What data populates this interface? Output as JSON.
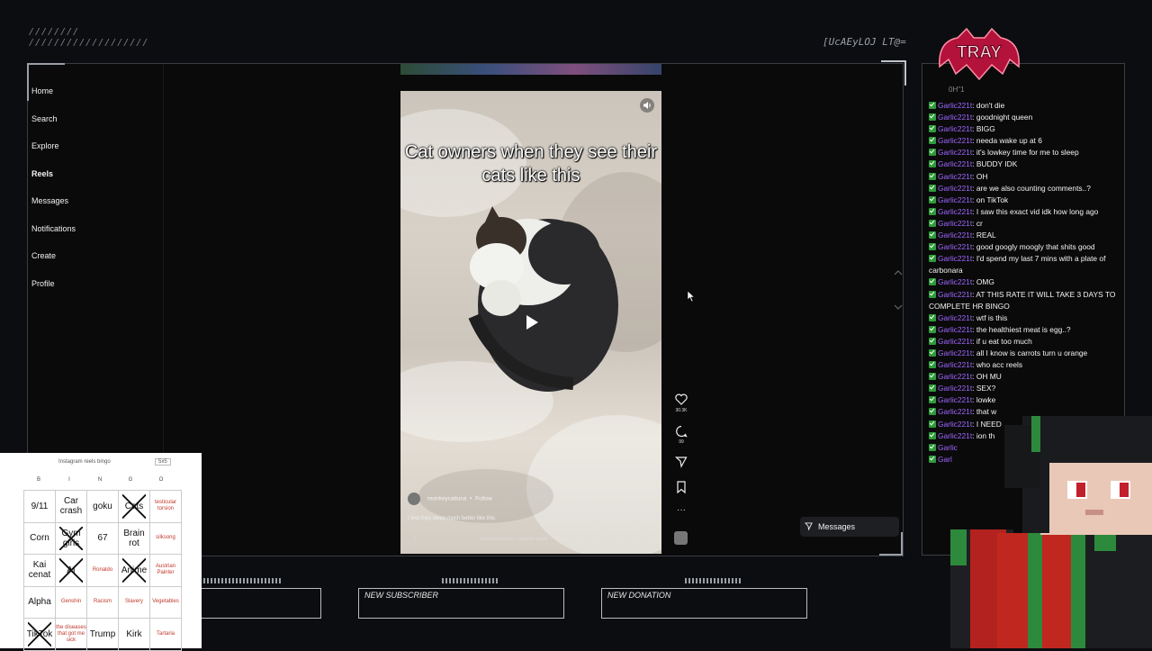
{
  "overlay": {
    "top_left_hatch_1": "////////",
    "top_left_hatch_2": "///////////////////",
    "top_code": "[UcAEyLOJ LT@=",
    "logo_text": "TRAY",
    "chat_top_text": "0H\"1"
  },
  "sidebar": {
    "items": [
      {
        "label": "Home"
      },
      {
        "label": "Search"
      },
      {
        "label": "Explore"
      },
      {
        "label": "Reels",
        "active": true
      },
      {
        "label": "Messages"
      },
      {
        "label": "Notifications"
      },
      {
        "label": "Create"
      },
      {
        "label": "Profile"
      }
    ]
  },
  "reel": {
    "caption": "Cat owners when they see their cats like this",
    "username": "monkeycatluna",
    "follow_label": "Follow",
    "description": "I feel they sleep much better like this",
    "audio": "monkeycatluna · Original audio",
    "like_count": "30.3K",
    "comment_count": "99"
  },
  "messages_button": {
    "label": "Messages"
  },
  "alerts": {
    "new_subscriber": "NEW SUBSCRIBER",
    "new_donation": "NEW DONATION"
  },
  "chat": {
    "messages": [
      {
        "user": "Garlic221t",
        "text": "don't die"
      },
      {
        "user": "Garlic221t",
        "text": "goodnight queen"
      },
      {
        "user": "Garlic221t",
        "text": "BIGG"
      },
      {
        "user": "Garlic221t",
        "text": "needa wake up at 6"
      },
      {
        "user": "Garlic221t",
        "text": "it's lowkey time for me to sleep"
      },
      {
        "user": "Garlic221t",
        "text": "BUDDY IDK"
      },
      {
        "user": "Garlic221t",
        "text": "OH"
      },
      {
        "user": "Garlic221t",
        "text": "are we also counting comments..?"
      },
      {
        "user": "Garlic221t",
        "text": "on TikTok"
      },
      {
        "user": "Garlic221t",
        "text": "I saw this exact vid idk how long ago"
      },
      {
        "user": "Garlic221t",
        "text": "cr"
      },
      {
        "user": "Garlic221t",
        "text": "REAL"
      },
      {
        "user": "Garlic221t",
        "text": "good googly moogly that shits good"
      },
      {
        "user": "Garlic221t",
        "text": "I'd spend my last 7 mins with a plate of carbonara"
      },
      {
        "user": "Garlic221t",
        "text": "OMG"
      },
      {
        "user": "Garlic221t",
        "text": "AT THIS RATE IT WILL TAKE 3 DAYS TO COMPLETE HR BINGO"
      },
      {
        "user": "Garlic221t",
        "text": "wtf is this"
      },
      {
        "user": "Garlic221t",
        "text": "the healthiest meat is egg..?"
      },
      {
        "user": "Garlic221t",
        "text": "if u eat too much"
      },
      {
        "user": "Garlic221t",
        "text": "all I know is carrots turn u orange"
      },
      {
        "user": "Garlic221t",
        "text": "who acc reels"
      },
      {
        "user": "Garlic221t",
        "text": "OH MU"
      },
      {
        "user": "Garlic221t",
        "text": "SEX?"
      },
      {
        "user": "Garlic221t",
        "text": "lowke"
      },
      {
        "user": "Garlic221t",
        "text": "that w"
      },
      {
        "user": "Garlic221t",
        "text": "I NEED"
      },
      {
        "user": "Garlic221t",
        "text": "ion th"
      },
      {
        "user": "Garlic",
        "text": ""
      },
      {
        "user": "Garl",
        "text": ""
      }
    ]
  },
  "bingo": {
    "title": "Instagram reels bingo",
    "size": "5x5",
    "columns": [
      "B",
      "I",
      "N",
      "G",
      "O"
    ],
    "cells": [
      [
        {
          "t": "9/11"
        },
        {
          "t": "Car crash"
        },
        {
          "t": "goku"
        },
        {
          "t": "Cats",
          "x": true
        },
        {
          "t": "testicular torsion",
          "small": true
        }
      ],
      [
        {
          "t": "Corn"
        },
        {
          "t": "Gym girls",
          "x": true
        },
        {
          "t": "67"
        },
        {
          "t": "Brain rot"
        },
        {
          "t": "silksong",
          "small": true
        }
      ],
      [
        {
          "t": "Kai cenat"
        },
        {
          "t": "AI",
          "x": true
        },
        {
          "t": "Ronaldo",
          "small": true
        },
        {
          "t": "Anime",
          "x": true
        },
        {
          "t": "Austrian Painter",
          "small": true
        }
      ],
      [
        {
          "t": "Alpha"
        },
        {
          "t": "Genshin",
          "small": true
        },
        {
          "t": "Racism",
          "small": true
        },
        {
          "t": "Slavery",
          "small": true
        },
        {
          "t": "Vegetables",
          "small": true
        }
      ],
      [
        {
          "t": "TikTok",
          "x": true
        },
        {
          "t": "the diseases that got me sick",
          "small": true
        },
        {
          "t": "Trump"
        },
        {
          "t": "Kirk"
        },
        {
          "t": "Tartaria",
          "small": true
        }
      ]
    ]
  },
  "colors": {
    "background": "#0c0d10",
    "chat_username": "#a066ff",
    "check_green": "#2e9b3a",
    "logo_red": "#b3123a"
  },
  "icons": [
    "sound-icon",
    "play-icon",
    "heart-icon",
    "comment-icon",
    "share-icon",
    "bookmark-icon",
    "more-icon",
    "audio-thumb-icon",
    "chevron-up-icon",
    "chevron-down-icon",
    "cursor-icon",
    "send-icon",
    "music-note-icon"
  ]
}
